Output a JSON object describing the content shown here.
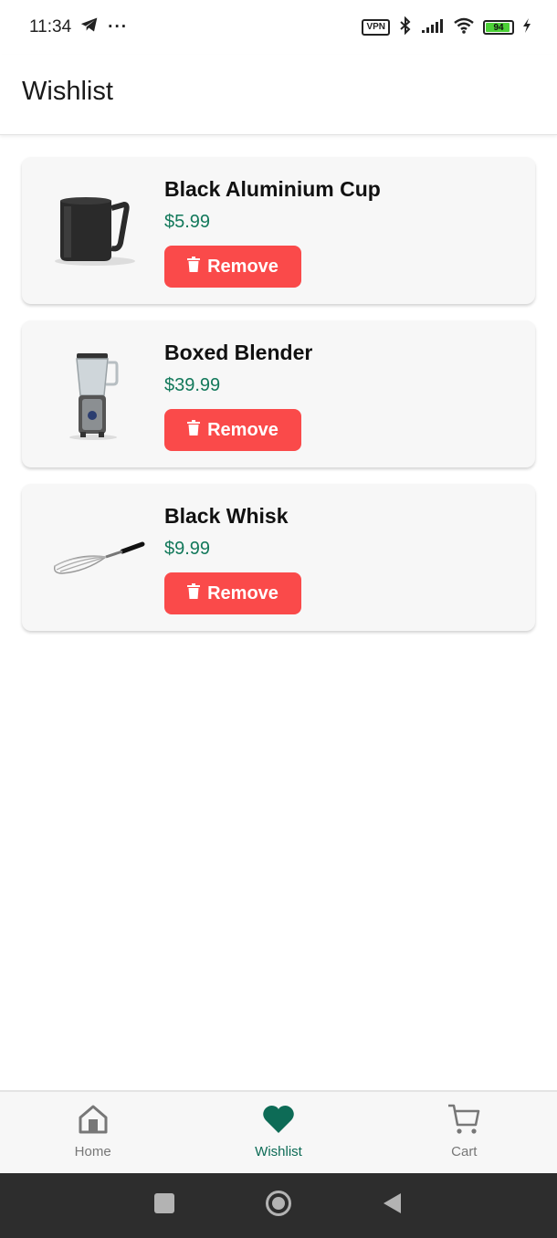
{
  "status_bar": {
    "time": "11:34",
    "more": "···",
    "vpn": "VPN",
    "battery": "94",
    "icons": [
      "telegram-icon",
      "bluetooth-icon",
      "signal-icon",
      "wifi-icon",
      "battery-icon",
      "charging-icon"
    ]
  },
  "header": {
    "title": "Wishlist"
  },
  "wishlist": {
    "items": [
      {
        "name": "Black Aluminium Cup",
        "price": "$5.99",
        "remove_label": "Remove",
        "image": "black-cup-image"
      },
      {
        "name": "Boxed Blender",
        "price": "$39.99",
        "remove_label": "Remove",
        "image": "blender-image"
      },
      {
        "name": "Black Whisk",
        "price": "$9.99",
        "remove_label": "Remove",
        "image": "whisk-image"
      }
    ]
  },
  "bottom_nav": {
    "items": [
      {
        "label": "Home",
        "icon": "home-icon",
        "active": false
      },
      {
        "label": "Wishlist",
        "icon": "heart-icon",
        "active": true
      },
      {
        "label": "Cart",
        "icon": "cart-icon",
        "active": false
      }
    ]
  },
  "colors": {
    "accent": "#0d6b56",
    "price": "#13795b",
    "remove_button": "#fa4a4a",
    "card_bg": "#f7f7f7",
    "system_nav": "#2d2d2d"
  }
}
